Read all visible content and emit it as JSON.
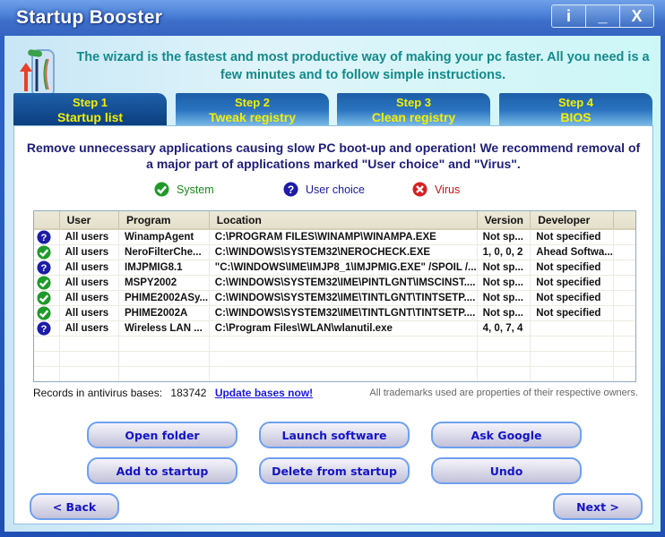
{
  "window": {
    "title": "Startup Booster",
    "buttons": {
      "info": "i",
      "minimize": "_",
      "close": "X"
    }
  },
  "intro": "The wizard is the fastest and most productive way of making your pc faster. All you need is a few minutes and to follow simple instructions.",
  "tabs": [
    {
      "step": "Step 1",
      "label": "Startup list",
      "active": true
    },
    {
      "step": "Step 2",
      "label": "Tweak registry",
      "active": false
    },
    {
      "step": "Step 3",
      "label": "Clean registry",
      "active": false
    },
    {
      "step": "Step 4",
      "label": "BIOS",
      "active": false
    }
  ],
  "warning": "Remove unnecessary applications causing slow PC boot-up and operation! We recommend removal of a major part of applications marked \"User choice\" and \"Virus\".",
  "legend": {
    "system": {
      "label": "System",
      "color": "#1a8a1a",
      "icon": "check-icon"
    },
    "user_choice": {
      "label": "User choice",
      "color": "#1a1aa0",
      "icon": "question-icon"
    },
    "virus": {
      "label": "Virus",
      "color": "#d01010",
      "icon": "x-icon"
    }
  },
  "table": {
    "columns": [
      "",
      "User",
      "Program",
      "Location",
      "Version",
      "Developer",
      ""
    ],
    "rows": [
      {
        "status": "user_choice",
        "user": "All users",
        "program": "WinampAgent",
        "location": "C:\\PROGRAM FILES\\WINAMP\\WINAMPA.EXE",
        "version": "Not sp...",
        "developer": "Not specified"
      },
      {
        "status": "system",
        "user": "All users",
        "program": "NeroFilterChe...",
        "location": "C:\\WINDOWS\\SYSTEM32\\NEROCHECK.EXE",
        "version": "1, 0, 0, 2",
        "developer": "Ahead Softwa..."
      },
      {
        "status": "user_choice",
        "user": "All users",
        "program": "IMJPMIG8.1",
        "location": "\"C:\\WINDOWS\\IME\\IMJP8_1\\IMJPMIG.EXE\" /SPOIL /...",
        "version": "Not sp...",
        "developer": "Not specified"
      },
      {
        "status": "system",
        "user": "All users",
        "program": "MSPY2002",
        "location": "C:\\WINDOWS\\SYSTEM32\\IME\\PINTLGNT\\IMSCINST....",
        "version": "Not sp...",
        "developer": "Not specified"
      },
      {
        "status": "system",
        "user": "All users",
        "program": "PHIME2002ASy...",
        "location": "C:\\WINDOWS\\SYSTEM32\\IME\\TINTLGNT\\TINTSETP....",
        "version": "Not sp...",
        "developer": "Not specified"
      },
      {
        "status": "system",
        "user": "All users",
        "program": "PHIME2002A",
        "location": "C:\\WINDOWS\\SYSTEM32\\IME\\TINTLGNT\\TINTSETP....",
        "version": "Not sp...",
        "developer": "Not specified"
      },
      {
        "status": "user_choice",
        "user": "All users",
        "program": "Wireless LAN ...",
        "location": "C:\\Program Files\\WLAN\\wlanutil.exe",
        "version": "4, 0, 7, 4",
        "developer": ""
      }
    ]
  },
  "records": {
    "label": "Records in antivirus bases:",
    "count": "183742",
    "update_link": "Update bases now!"
  },
  "trademark": "All trademarks used are properties of their respective owners.",
  "actions": {
    "open_folder": "Open folder",
    "launch_software": "Launch software",
    "ask_google": "Ask Google",
    "add_to_startup": "Add to startup",
    "delete_from_startup": "Delete from startup",
    "undo": "Undo",
    "back": "< Back",
    "next": "Next >"
  }
}
